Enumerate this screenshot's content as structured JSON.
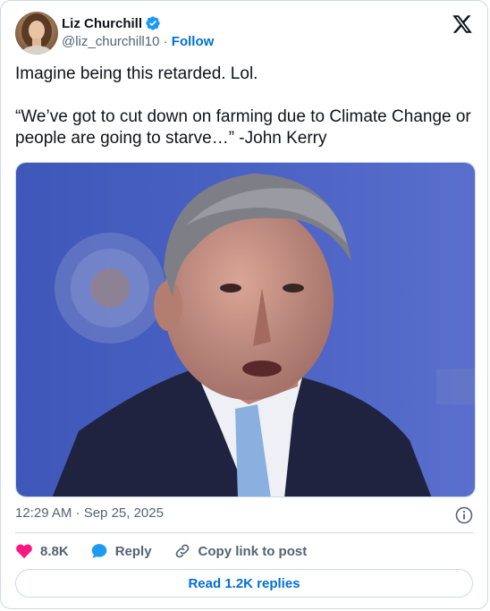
{
  "author": {
    "display_name": "Liz Churchill",
    "handle": "@liz_churchill10",
    "separator": "·",
    "follow_label": "Follow",
    "verified_color": "#1d9bf0"
  },
  "tweet": {
    "text": "Imagine being this retarded. Lol.\n\n“We’ve got to cut down on farming due to Climate Change or people are going to starve…” -John Kerry"
  },
  "meta": {
    "timestamp": "12:29 AM · Sep 25, 2025"
  },
  "actions": {
    "likes": "8.8K",
    "reply_label": "Reply",
    "copy_label": "Copy link to post"
  },
  "read_replies_label": "Read 1.2K replies",
  "colors": {
    "accent": "#006fd6",
    "like": "#f91880",
    "reply": "#1d9bf0",
    "muted": "#536471"
  },
  "icons": [
    "verified-badge-icon",
    "x-logo-icon",
    "info-icon",
    "heart-icon",
    "reply-bubble-icon",
    "link-icon"
  ]
}
